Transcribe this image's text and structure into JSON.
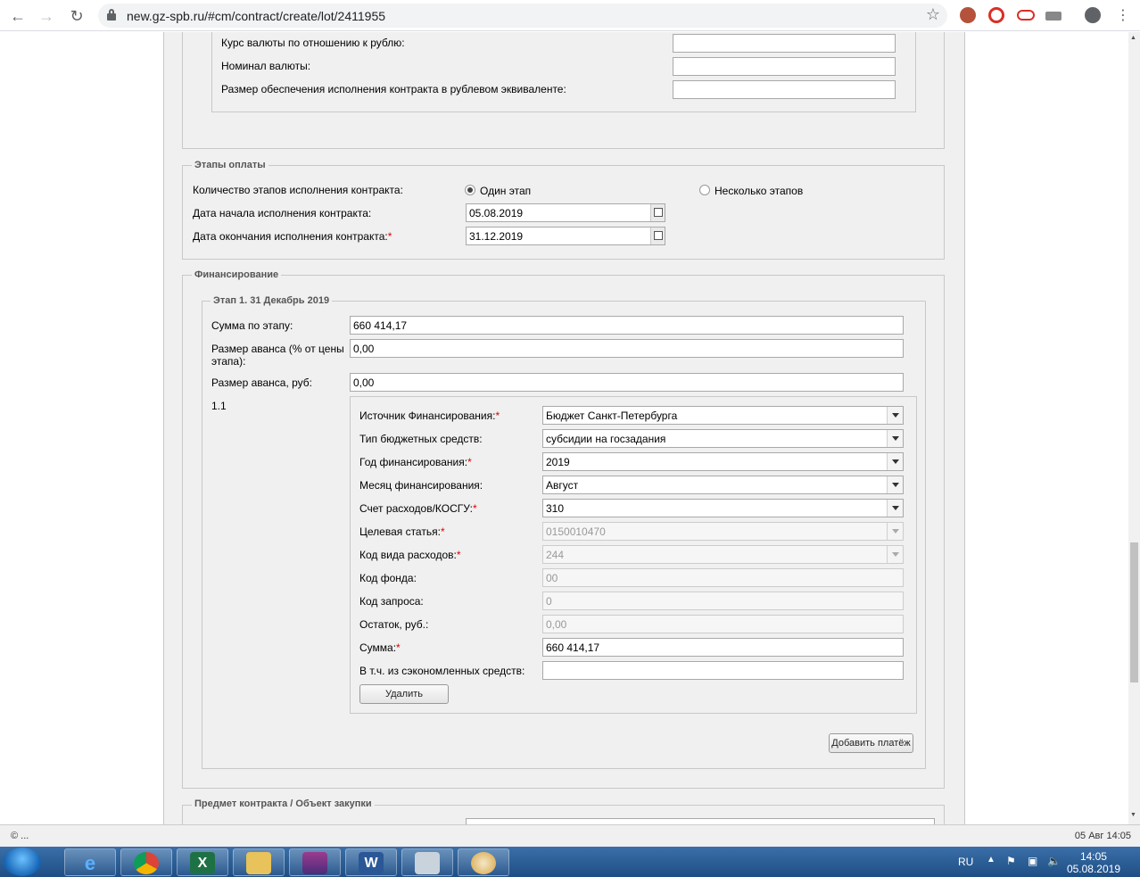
{
  "browser": {
    "url": "new.gz-spb.ru/#cm/contract/create/lot/2411955"
  },
  "currency": {
    "rate_label": "Курс валюты по отношению к рублю:",
    "rate_value": "",
    "nominal_label": "Номинал валюты:",
    "nominal_value": "",
    "guarantee_label": "Размер обеспечения исполнения контракта в рублевом эквиваленте:",
    "guarantee_value": ""
  },
  "payment_stages": {
    "legend": "Этапы оплаты",
    "count_label": "Количество этапов исполнения контракта:",
    "option_one": "Один этап",
    "option_many": "Несколько этапов",
    "selected": "Один этап",
    "start_label": "Дата начала исполнения контракта:",
    "start_value": "05.08.2019",
    "end_label": "Дата окончания исполнения контракта:",
    "end_value": "31.12.2019",
    "required_mark": "*"
  },
  "financing": {
    "legend": "Финансирование",
    "stage_legend": "Этап 1. 31 Декабрь 2019",
    "sum_label": "Сумма по этапу:",
    "sum_value": "660 414,17",
    "advance_pct_label_1": "Размер аванса (% от цены",
    "advance_pct_label_2": "этапа):",
    "advance_pct_value": "0,00",
    "advance_rub_label": "Размер аванса, руб:",
    "advance_rub_value": "0,00",
    "payment_number": "1.1",
    "source_label": "Источник Финансирования:",
    "source_value": "Бюджет Санкт-Петербурга",
    "budget_type_label": "Тип бюджетных средств:",
    "budget_type_value": "субсидии на госзадания",
    "year_label": "Год финансирования:",
    "year_value": "2019",
    "month_label": "Месяц финансирования:",
    "month_value": "Август",
    "account_label": "Счет расходов/КОСГУ:",
    "account_value": "310",
    "target_label": "Целевая статья:",
    "target_value": "0150010470",
    "expense_code_label": "Код вида расходов:",
    "expense_code_value": "244",
    "fund_code_label": "Код фонда:",
    "fund_code_value": "00",
    "request_code_label": "Код запроса:",
    "request_code_value": "0",
    "balance_label": "Остаток, руб.:",
    "balance_value": "0,00",
    "amount_label": "Сумма:",
    "amount_value": "660 414,17",
    "savings_label": "В т.ч. из сэкономленных средств:",
    "savings_value": "",
    "delete_button": "Удалить",
    "add_payment_button": "Добавить платёж"
  },
  "subject": {
    "legend": "Предмет контракта / Объект закупки"
  },
  "status_bar": {
    "left": "© ...",
    "right": "05 Авг 14:05"
  },
  "taskbar": {
    "lang": "RU",
    "time": "14:05",
    "date": "05.08.2019"
  }
}
